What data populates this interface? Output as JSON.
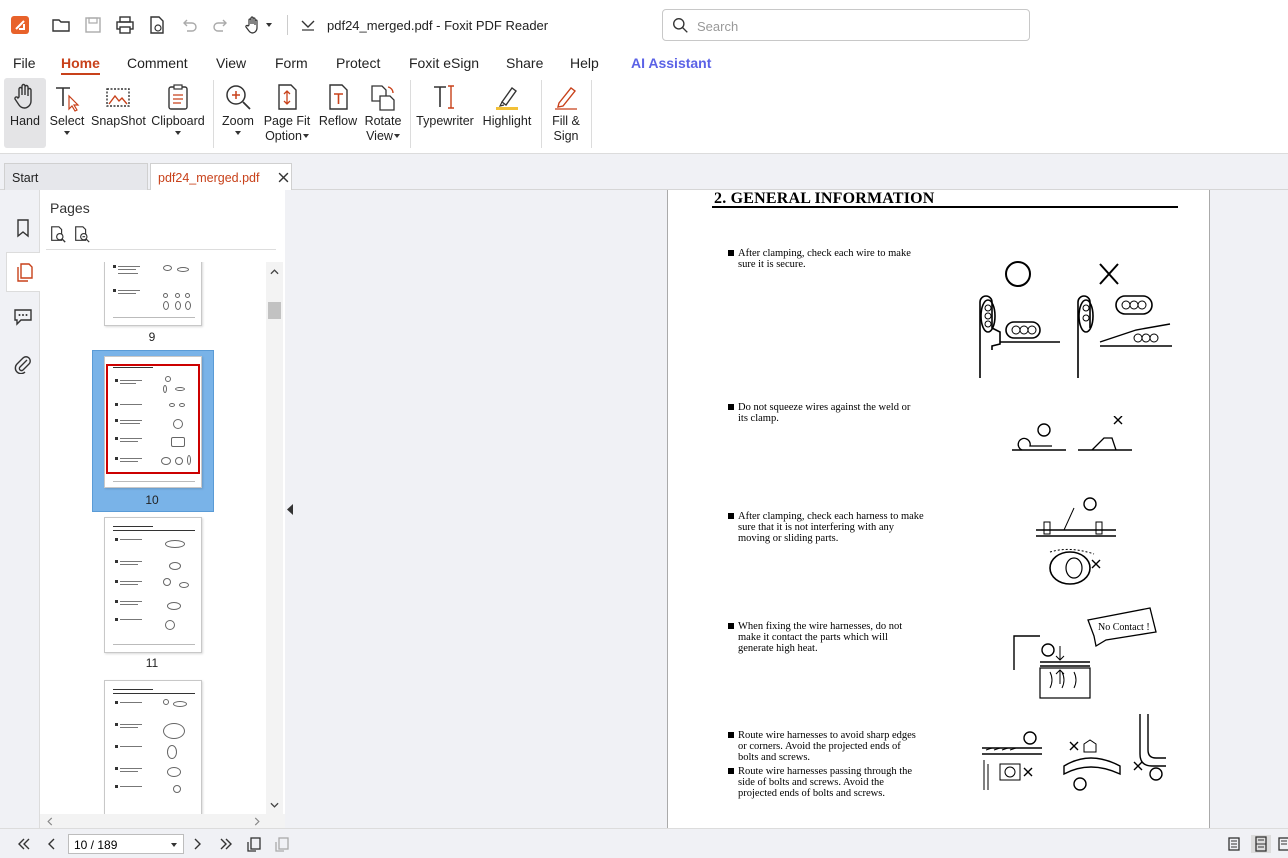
{
  "window": {
    "title": "pdf24_merged.pdf - Foxit PDF Reader"
  },
  "search": {
    "placeholder": "Search"
  },
  "menu": {
    "items": [
      "File",
      "Home",
      "Comment",
      "View",
      "Form",
      "Protect",
      "Foxit eSign",
      "Share",
      "Help",
      "AI Assistant"
    ]
  },
  "ribbon": {
    "hand": "Hand",
    "select": "Select",
    "snapshot": "SnapShot",
    "clipboard": "Clipboard",
    "zoom": "Zoom",
    "page_fit_1": "Page Fit",
    "page_fit_2": "Option",
    "reflow": "Reflow",
    "rotate_1": "Rotate",
    "rotate_2": "View",
    "typewriter": "Typewriter",
    "highlight": "Highlight",
    "fill_1": "Fill &",
    "fill_2": "Sign"
  },
  "tabs": {
    "start": "Start",
    "doc": "pdf24_merged.pdf"
  },
  "panel": {
    "title": "Pages",
    "page_labels": [
      "9",
      "10",
      "11"
    ]
  },
  "document": {
    "heading": "2. GENERAL INFORMATION",
    "bullets": [
      [
        "After clamping, check each wire to make",
        "sure it is secure."
      ],
      [
        "Do not squeeze wires against the weld or",
        "its clamp."
      ],
      [
        "After clamping, check each harness to make",
        "sure that it is not interfering with any",
        "moving or sliding parts."
      ],
      [
        "When fixing the wire harnesses, do not",
        "make it contact the parts which will",
        "generate high heat."
      ],
      [
        "Route wire harnesses to avoid sharp edges",
        "or corners.  Avoid the projected ends of",
        "bolts and screws."
      ],
      [
        "Route wire harnesses passing through the",
        "side of bolts and screws.  Avoid the",
        "projected ends of bolts and screws."
      ]
    ],
    "callout": "No Contact !"
  },
  "status": {
    "page": "10 / 189"
  },
  "colors": {
    "accent": "#c8411a",
    "ai": "#5b62e6",
    "thumb_selected": "#79b3e8",
    "thumb_border": "#cc0000"
  }
}
